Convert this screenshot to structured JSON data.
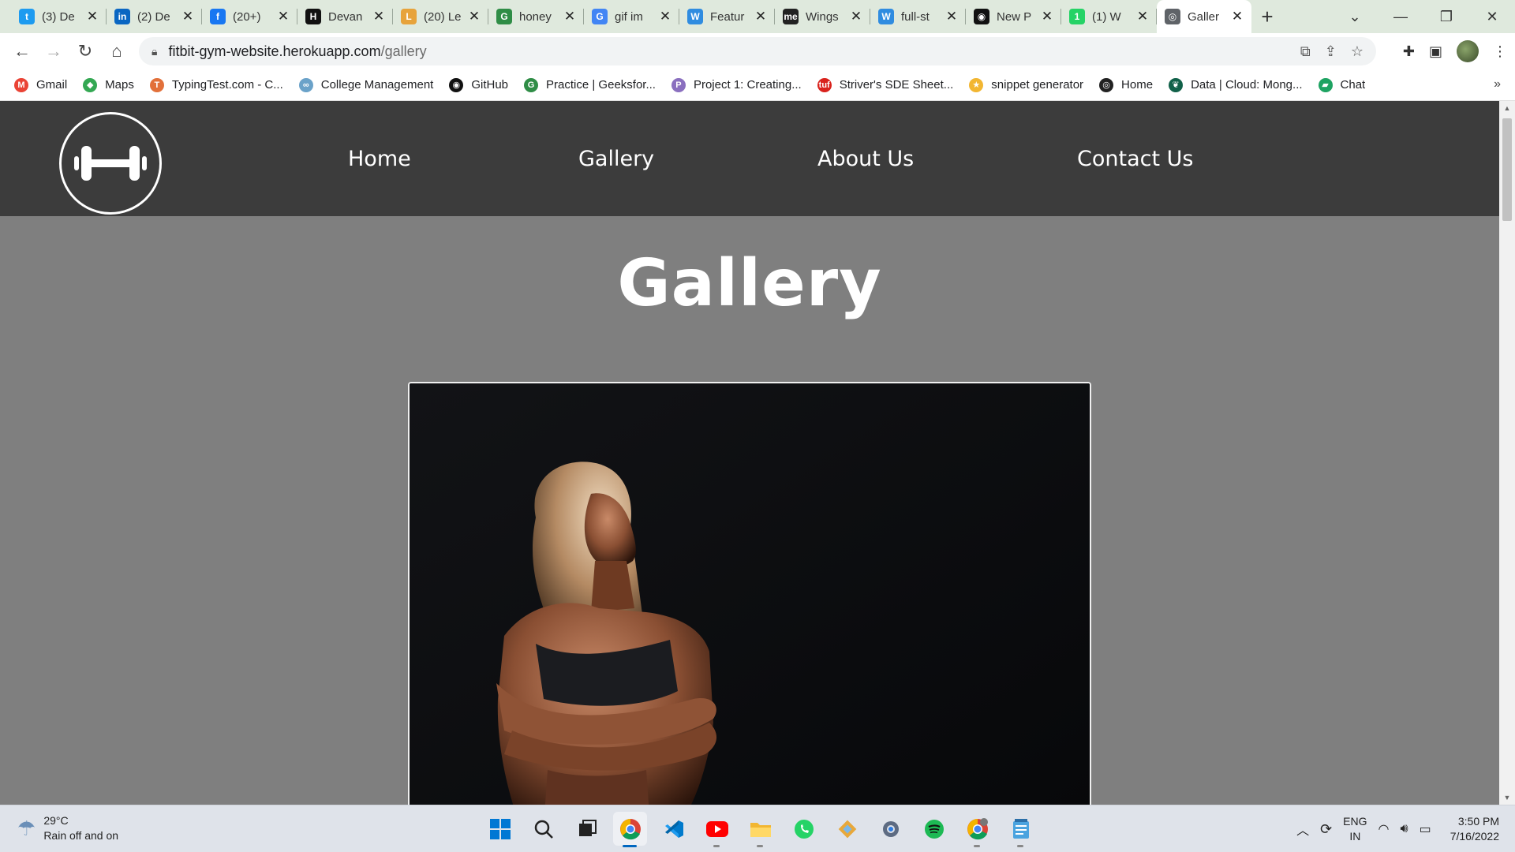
{
  "browser": {
    "tabs": [
      {
        "title": "(3) De",
        "icon": "twitter-icon",
        "color": "#1d9bf0",
        "glyph": "t"
      },
      {
        "title": "(2) De",
        "icon": "linkedin-icon",
        "color": "#0a66c2",
        "glyph": "in"
      },
      {
        "title": "(20+)",
        "icon": "facebook-icon",
        "color": "#1877f2",
        "glyph": "f"
      },
      {
        "title": "Devan",
        "icon": "hackerrank-icon",
        "color": "#111111",
        "glyph": "H"
      },
      {
        "title": "(20) Le",
        "icon": "leetcode-icon",
        "color": "#e7a33b",
        "glyph": "L"
      },
      {
        "title": "honey",
        "icon": "geeksforgeeks-icon",
        "color": "#2f8d46",
        "glyph": "G"
      },
      {
        "title": "gif im",
        "icon": "google-icon",
        "color": "#4285f4",
        "glyph": "G"
      },
      {
        "title": "Featur",
        "icon": "wordpress-icon",
        "color": "#2f8ce0",
        "glyph": "W"
      },
      {
        "title": "Wings",
        "icon": "medium-icon",
        "color": "#222222",
        "glyph": "me"
      },
      {
        "title": "full-st",
        "icon": "wordpress-icon",
        "color": "#2f8ce0",
        "glyph": "W"
      },
      {
        "title": "New P",
        "icon": "github-icon",
        "color": "#111111",
        "glyph": "◉"
      },
      {
        "title": "(1) W",
        "icon": "whatsapp-icon",
        "color": "#25d366",
        "glyph": "1"
      },
      {
        "title": "Galler",
        "icon": "globe-icon",
        "color": "#5f6368",
        "glyph": "◎"
      }
    ],
    "active_tab_index": 12,
    "url_host": "fitbit-gym-website.herokuapp.com",
    "url_path": "/gallery",
    "bookmarks": [
      {
        "label": "Gmail",
        "icon": "gmail-icon",
        "color": "#ea4335",
        "glyph": "M"
      },
      {
        "label": "Maps",
        "icon": "maps-icon",
        "color": "#34a853",
        "glyph": "◆"
      },
      {
        "label": "TypingTest.com - C...",
        "icon": "typingtest-icon",
        "color": "#e2703a",
        "glyph": "T"
      },
      {
        "label": "College Management",
        "icon": "link-icon",
        "color": "#6aa2c9",
        "glyph": "∞"
      },
      {
        "label": "GitHub",
        "icon": "github-icon",
        "color": "#111111",
        "glyph": "◉"
      },
      {
        "label": "Practice | Geeksfor...",
        "icon": "geeksforgeeks-icon",
        "color": "#2f8d46",
        "glyph": "G"
      },
      {
        "label": "Project 1: Creating...",
        "icon": "project-avatar-icon",
        "color": "#8a6fbf",
        "glyph": "P"
      },
      {
        "label": "Striver's SDE Sheet...",
        "icon": "takeuforward-icon",
        "color": "#d9221c",
        "glyph": "tuf"
      },
      {
        "label": "snippet generator",
        "icon": "snippet-icon",
        "color": "#f2b632",
        "glyph": "★"
      },
      {
        "label": "Home",
        "icon": "globe-icon",
        "color": "#222222",
        "glyph": "◎"
      },
      {
        "label": "Data | Cloud: Mong...",
        "icon": "mongodb-icon",
        "color": "#116149",
        "glyph": "❦"
      },
      {
        "label": "Chat",
        "icon": "google-chat-icon",
        "color": "#1ea362",
        "glyph": "▰"
      }
    ]
  },
  "site": {
    "nav": [
      {
        "label": "Home",
        "name": "nav-home-link"
      },
      {
        "label": "Gallery",
        "name": "nav-gallery-link"
      },
      {
        "label": "About Us",
        "name": "nav-about-link"
      },
      {
        "label": "Contact Us",
        "name": "nav-contact-link"
      }
    ],
    "page_title": "Gallery",
    "colors": {
      "nav_bg": "#3c3c3c",
      "page_bg": "#7f7f7f",
      "text": "#ffffff"
    }
  },
  "taskbar": {
    "weather_temp": "29°C",
    "weather_desc": "Rain off and on",
    "lang_1": "ENG",
    "lang_2": "IN",
    "time": "3:50 PM",
    "date": "7/16/2022",
    "apps": [
      "start-icon",
      "search-icon",
      "task-view-icon",
      "chrome-icon",
      "vscode-icon",
      "youtube-icon",
      "file-explorer-icon",
      "whatsapp-icon",
      "git-icon",
      "settings-icon",
      "spotify-icon",
      "chrome-profile-icon",
      "notepad-icon"
    ]
  }
}
